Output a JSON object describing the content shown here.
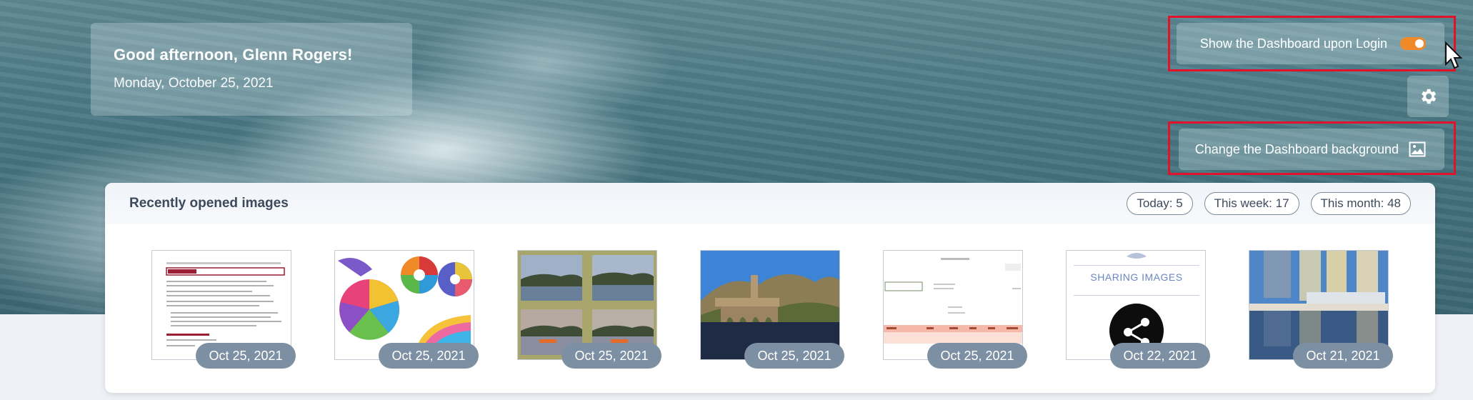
{
  "greeting": {
    "title": "Good afternoon, Glenn Rogers!",
    "date": "Monday, October 25, 2021"
  },
  "dashboard_controls": {
    "show_on_login_label": "Show the Dashboard upon Login",
    "show_on_login_enabled": true,
    "settings_icon": "gear-icon",
    "change_background_label": "Change the Dashboard background",
    "change_background_icon": "image-icon"
  },
  "recent": {
    "title": "Recently opened images",
    "stats": {
      "today": "Today: 5",
      "this_week": "This week: 17",
      "this_month": "This month: 48"
    },
    "items": [
      {
        "date": "Oct 25, 2021",
        "thumb": "document"
      },
      {
        "date": "Oct 25, 2021",
        "thumb": "color-wheels"
      },
      {
        "date": "Oct 25, 2021",
        "thumb": "lake-collage"
      },
      {
        "date": "Oct 25, 2021",
        "thumb": "bridge-landscape"
      },
      {
        "date": "Oct 25, 2021",
        "thumb": "table-sheet"
      },
      {
        "date": "Oct 22, 2021",
        "thumb": "sharing-images",
        "text": "SHARING IMAGES"
      },
      {
        "date": "Oct 21, 2021",
        "thumb": "city-reflection"
      }
    ]
  },
  "colors": {
    "toggle_on": "#f08a28",
    "highlight": "#e0132a",
    "badge": "#7d8fa3"
  }
}
